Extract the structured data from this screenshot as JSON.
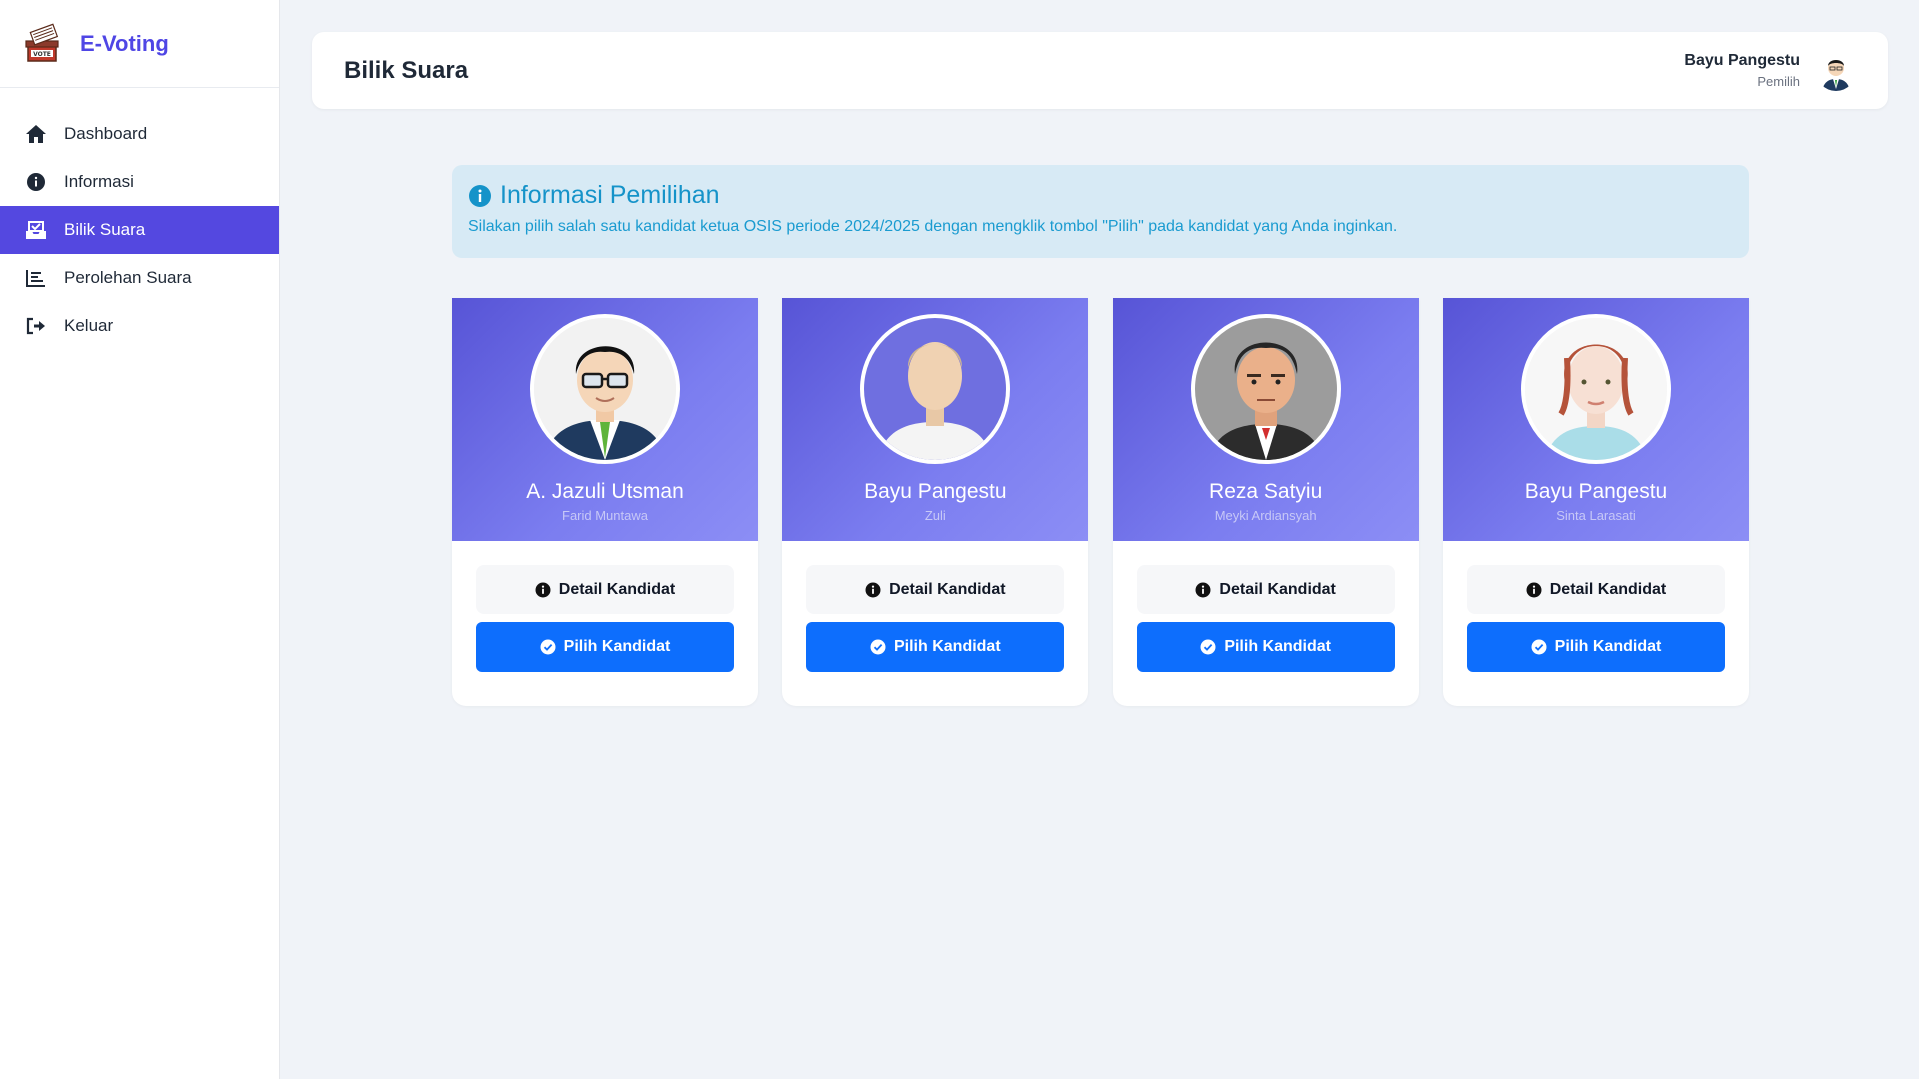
{
  "brand": {
    "name": "E-Voting",
    "logo_icon": "ballot-box-icon"
  },
  "sidebar": {
    "items": [
      {
        "label": "Dashboard",
        "icon": "home-icon",
        "active": false
      },
      {
        "label": "Informasi",
        "icon": "info-circle-icon",
        "active": false
      },
      {
        "label": "Bilik Suara",
        "icon": "inbox-check-icon",
        "active": true
      },
      {
        "label": "Perolehan Suara",
        "icon": "bar-chart-icon",
        "active": false
      },
      {
        "label": "Keluar",
        "icon": "logout-icon",
        "active": false
      }
    ]
  },
  "header": {
    "title": "Bilik Suara",
    "user": {
      "name": "Bayu Pangestu",
      "role": "Pemilih"
    }
  },
  "info": {
    "title": "Informasi Pemilihan",
    "description": "Silakan pilih salah satu kandidat ketua OSIS periode 2024/2025 dengan mengklik tombol \"Pilih\" pada kandidat yang Anda inginkan."
  },
  "candidates": [
    {
      "name": "A. Jazuli Utsman",
      "vice": "Farid Muntawa"
    },
    {
      "name": "Bayu Pangestu",
      "vice": "Zuli"
    },
    {
      "name": "Reza Satyiu",
      "vice": "Meyki Ardiansyah"
    },
    {
      "name": "Bayu Pangestu",
      "vice": "Sinta Larasati"
    }
  ],
  "buttons": {
    "detail": "Detail Kandidat",
    "pick": "Pilih Kandidat"
  },
  "colors": {
    "accent": "#5448e0",
    "primary_button": "#0d6efd",
    "info_bg": "#d7eaf5",
    "info_text": "#1593c9"
  }
}
